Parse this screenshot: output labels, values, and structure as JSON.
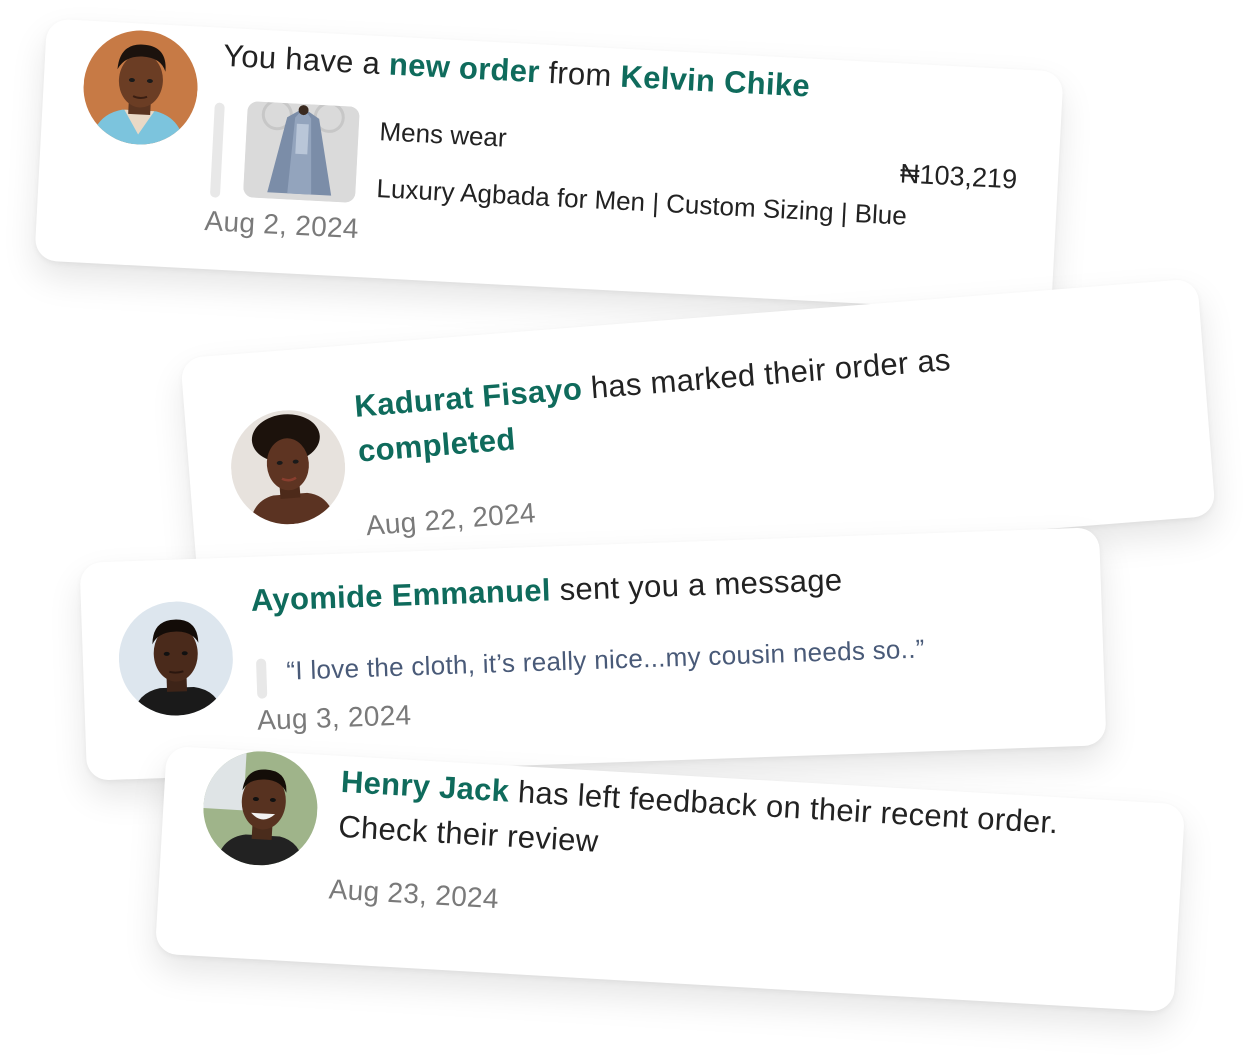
{
  "notifications": [
    {
      "prefix": "You have a ",
      "highlight": "new order",
      "middle": " from ",
      "name": "Kelvin Chike",
      "category": "Mens wear",
      "price": "₦103,219",
      "product": "Luxury Agbada for Men | Custom Sizing | Blue",
      "date": "Aug 2, 2024"
    },
    {
      "name": "Kadurat Fisayo",
      "text": "  has marked their order as ",
      "status": "completed",
      "date": "Aug 22, 2024"
    },
    {
      "name": "Ayomide Emmanuel",
      "text": " sent you a message",
      "quote": "“I love the cloth, it’s really nice...my cousin needs so..”",
      "date": "Aug 3, 2024"
    },
    {
      "name": "Henry Jack",
      "text": " has left feedback on their recent order. Check their review",
      "date": "Aug 23, 2024"
    }
  ],
  "colors": {
    "accent": "#0f6b5c",
    "text": "#222222",
    "date": "#7a7a7a",
    "quote": "#495a78"
  }
}
